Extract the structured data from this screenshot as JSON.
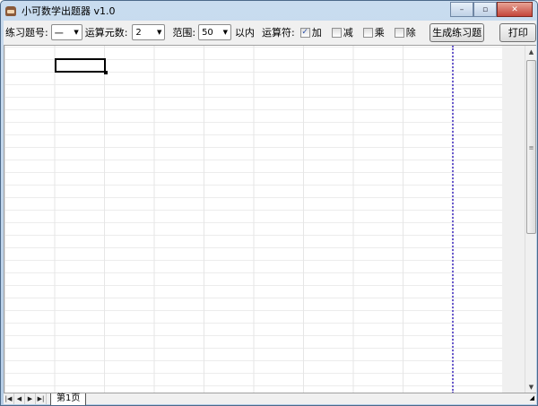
{
  "window": {
    "title": "小可数学出题器 v1.0",
    "minimize": "–",
    "maximize": "▫",
    "close": "✕"
  },
  "toolbar": {
    "problem_no_label": "练习题号:",
    "problem_no_value": "一",
    "operands_label": "运算元数:",
    "operands_value": "2",
    "range_label": "范围:",
    "range_value": "50",
    "range_suffix": "以内",
    "operators_label": "运算符:",
    "operators": [
      {
        "label": "加",
        "checked": true
      },
      {
        "label": "减",
        "checked": false
      },
      {
        "label": "乘",
        "checked": false
      },
      {
        "label": "除",
        "checked": false
      }
    ],
    "generate_button": "生成练习题",
    "print_button": "打印"
  },
  "sheet": {
    "tabs": [
      {
        "label": "第1页",
        "active": true
      }
    ],
    "nav": [
      "|◀",
      "◀",
      "▶",
      "▶|"
    ]
  },
  "colors": {
    "page_break": "#6a5acd",
    "selection": "#000000"
  }
}
